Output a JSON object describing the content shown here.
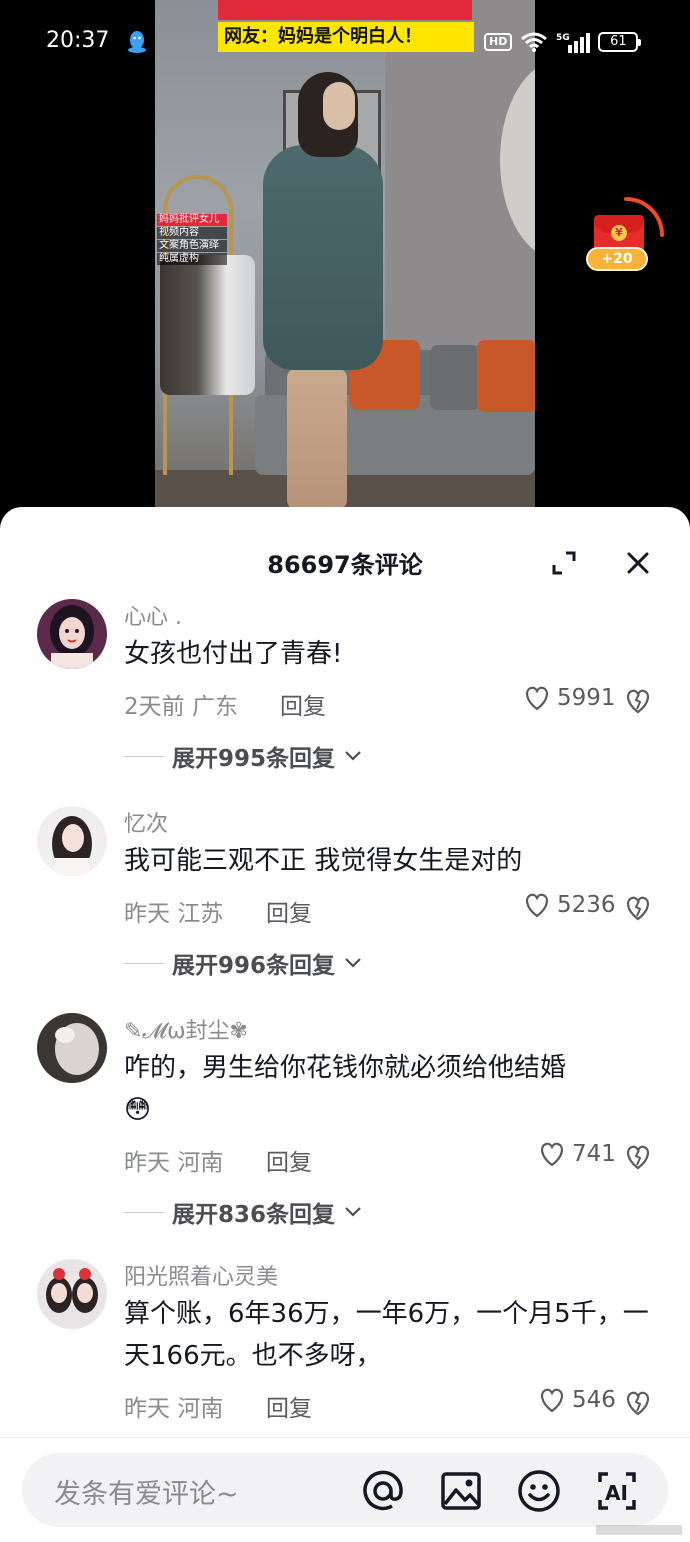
{
  "status_bar": {
    "time": "20:37",
    "hd_badge": "HD",
    "network": "5G",
    "battery": "61"
  },
  "video": {
    "banner_text": "网友：妈妈是个明白人！",
    "tag_lines": [
      "妈妈批评女儿",
      "视频内容",
      "文案角色演绎",
      "纯属虚构"
    ]
  },
  "red_packet": {
    "badge": "+20"
  },
  "comments_panel": {
    "title": "86697条评论",
    "comments": [
      {
        "name": "心心 .",
        "text": "女孩也付出了青春!",
        "time": "2天前",
        "location": "广东",
        "reply_label": "回复",
        "likes": "5991",
        "expand_label": "展开995条回复"
      },
      {
        "name": "忆次",
        "text": "我可能三观不正 我觉得女生是对的",
        "time": "昨天",
        "location": "江苏",
        "reply_label": "回复",
        "likes": "5236",
        "expand_label": "展开996条回复"
      },
      {
        "name": "✎𝓜ω封尘✾",
        "text": "咋的，男生给你花钱你就必须给他结婚",
        "emoji": "😳",
        "time": "昨天",
        "location": "河南",
        "reply_label": "回复",
        "likes": "741",
        "expand_label": "展开836条回复"
      },
      {
        "name": "阳光照着心灵美",
        "text": "算个账，6年36万，一年6万，一个月5千，一天166元。也不多呀，",
        "time": "昨天",
        "location": "河南",
        "reply_label": "回复",
        "likes": "546"
      }
    ]
  },
  "input_bar": {
    "placeholder": "发条有爱评论~",
    "icons": [
      "at-icon",
      "image-icon",
      "emoji-icon",
      "ai-icon"
    ]
  },
  "colors": {
    "panel_bg": "#ffffff",
    "text_primary": "#161823",
    "text_secondary": "#8a8b91",
    "banner_yellow": "#ffe600",
    "red_packet": "#e82c2c"
  }
}
